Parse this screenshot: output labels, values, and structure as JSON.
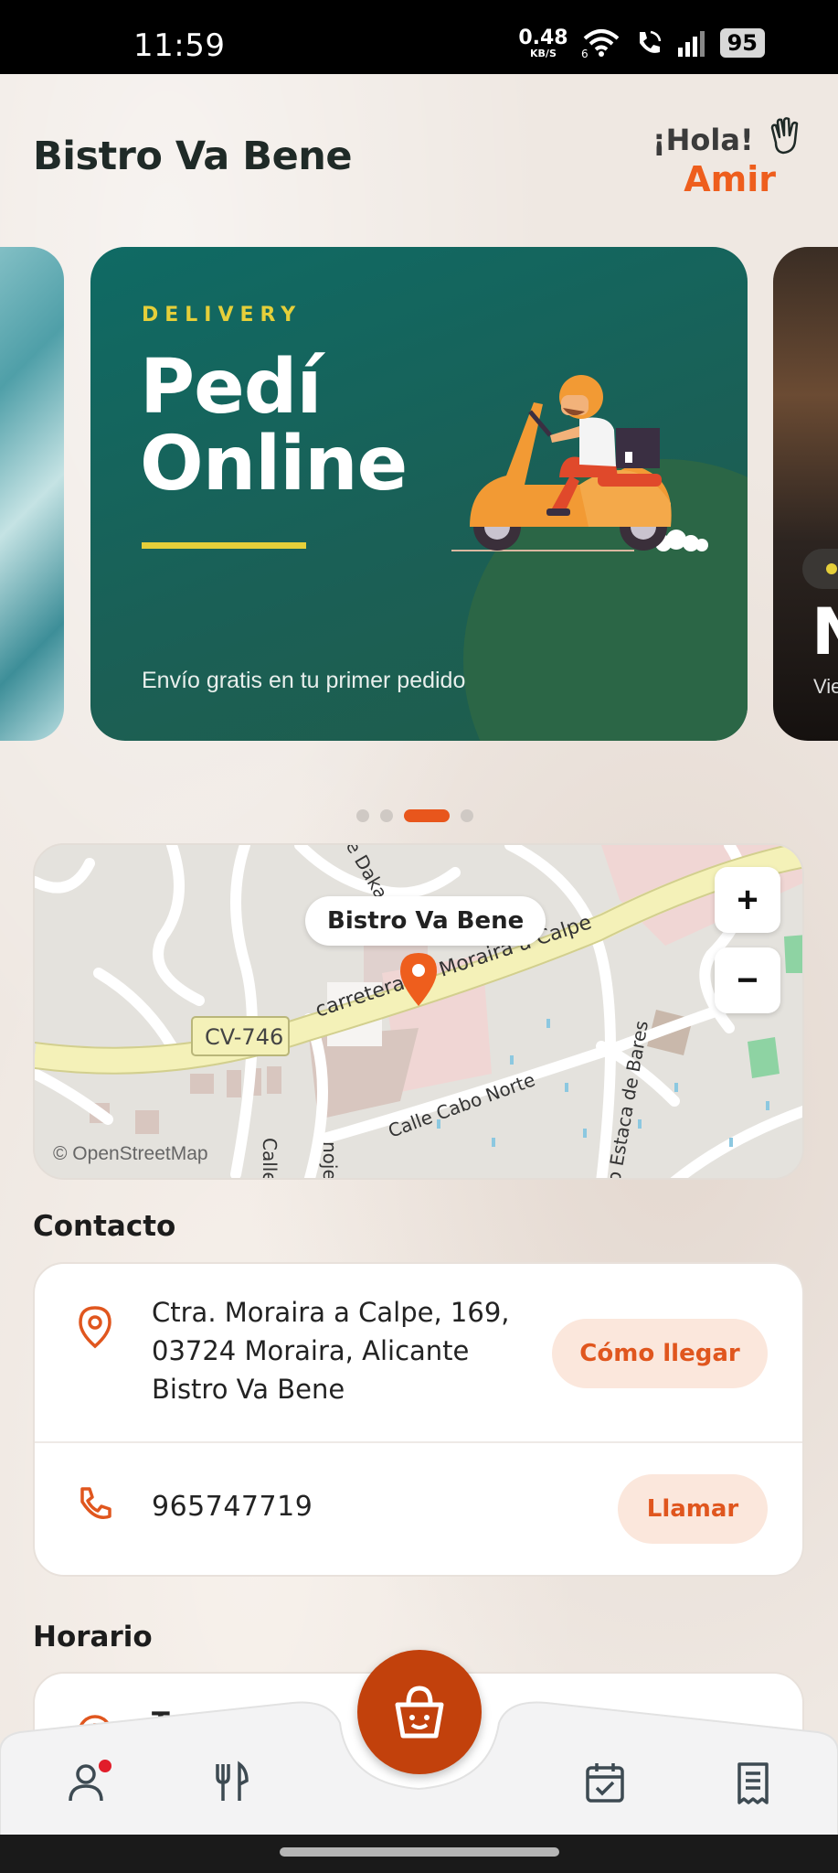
{
  "status_bar": {
    "time": "11:59",
    "net_speed_value": "0.48",
    "net_speed_unit": "KB/S",
    "battery": "95",
    "icons": [
      "wifi-6-icon",
      "wifi-call-icon",
      "signal-icon",
      "battery-icon"
    ]
  },
  "header": {
    "brand": "Bistro Va Bene",
    "greeting": "¡Hola!",
    "user_name": "Amir"
  },
  "carousel": {
    "active_index": 2,
    "dot_count": 4,
    "slide": {
      "eyebrow": "DELIVERY",
      "title_line1": "Pedí",
      "title_line2": "Online",
      "subtitle": "Envío gratis en tu primer pedido"
    },
    "next_slide": {
      "title_fragment": "N",
      "subtitle_fragment": "Vie"
    }
  },
  "map": {
    "label": "Bistro Va Bene",
    "zoom_in": "+",
    "zoom_out": "−",
    "attribution": "© OpenStreetMap",
    "street_labels": [
      "CV-746",
      "carretera de Moraira a Calpe",
      "Calle Cabo Norte",
      "o Estaca de Bares",
      "Calle C",
      "noje",
      "e Dakar"
    ]
  },
  "contact": {
    "title": "Contacto",
    "address": "Ctra. Moraira a Calpe, 169, 03724 Moraira, Alicante Bistro Va Bene",
    "directions_label": "Cómo llegar",
    "phone": "965747719",
    "call_label": "Llamar"
  },
  "schedule": {
    "title": "Horario",
    "first_row_partial": "To…   …s"
  },
  "bottom_nav": {
    "items": [
      "profile-icon",
      "menu-icon",
      "cart-icon",
      "reservations-icon",
      "orders-icon"
    ],
    "has_profile_notification": true
  },
  "colors": {
    "accent": "#ee5e1d",
    "fab": "#c2410c",
    "slide_bg": "#0f6a64",
    "slide_accent": "#e5cf3a",
    "pill_bg": "#fbe7dc"
  }
}
